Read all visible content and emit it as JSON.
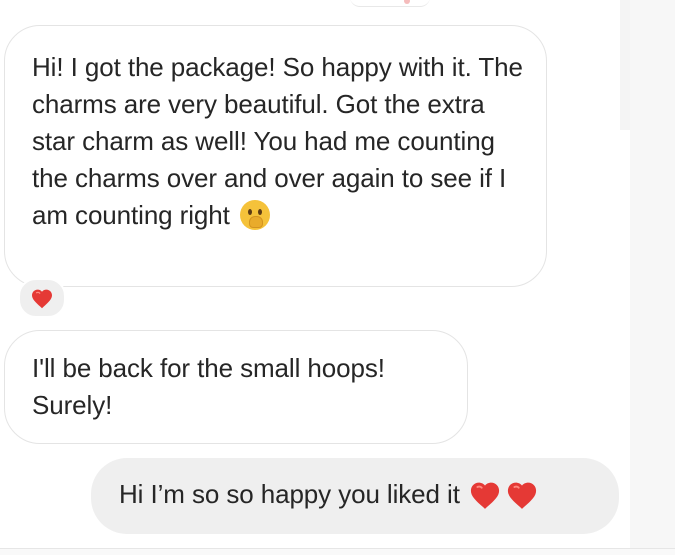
{
  "conversation": {
    "messages": [
      {
        "direction": "incoming",
        "text": "Hi! I got the package! So happy with it. The charms are very beautiful. Got the extra star charm as well! You had me counting the charms over and over again to see if I am counting right",
        "trailing_emoji": "shushing-face",
        "reaction": "red-heart"
      },
      {
        "direction": "incoming",
        "text": "I'll be back for the small hoops! Surely!"
      },
      {
        "direction": "outgoing",
        "text": "Hi I’m so so happy you liked it",
        "trailing_emojis": [
          "red-heart",
          "red-heart"
        ]
      }
    ]
  },
  "colors": {
    "incoming_bubble": "#ffffff",
    "incoming_border": "#e4e4e4",
    "outgoing_bubble": "#efefef",
    "text": "#262626",
    "heart": "#e53935"
  },
  "icons": {
    "reaction": "heart-icon",
    "emoji_1": "shushing-face-emoji",
    "emoji_2": "heart-icon"
  }
}
